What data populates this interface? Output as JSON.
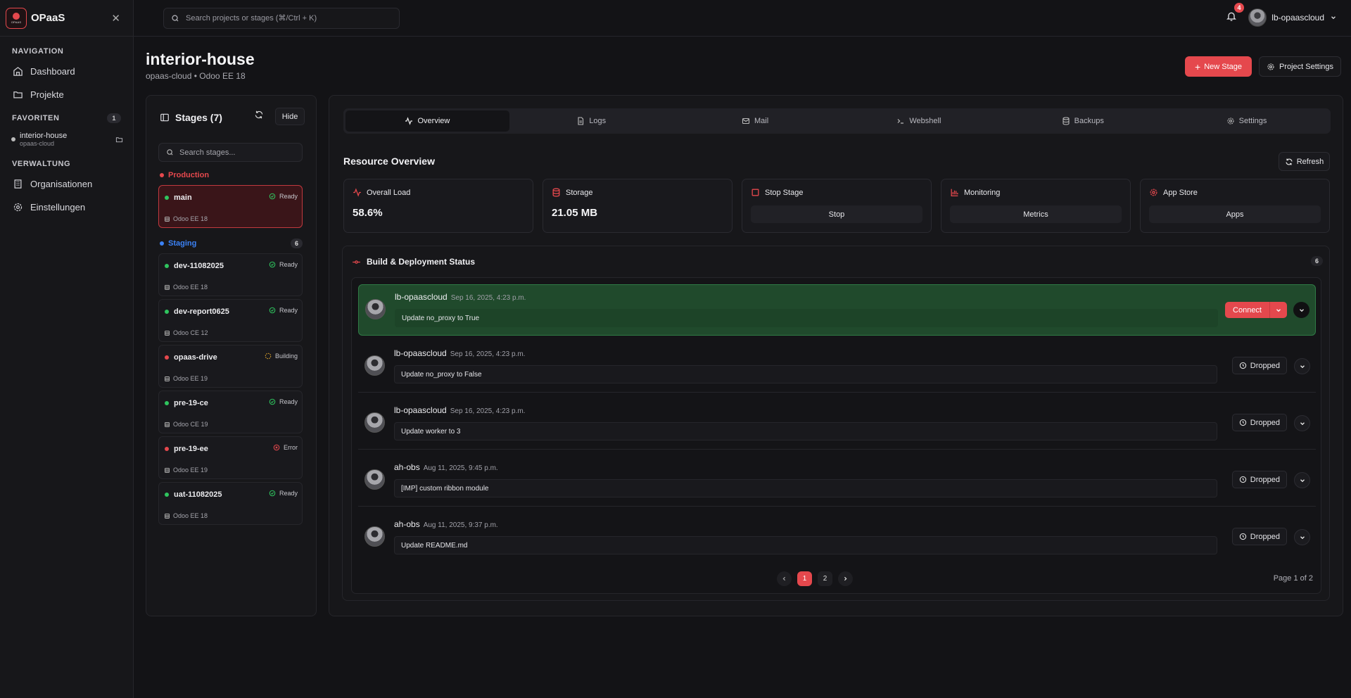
{
  "app": {
    "name": "OPaaS",
    "logo_text": "OPAAS"
  },
  "sidebar": {
    "nav_title": "NAVIGATION",
    "nav": [
      {
        "label": "Dashboard",
        "icon": "home-icon"
      },
      {
        "label": "Projekte",
        "icon": "folder-icon"
      }
    ],
    "fav_title": "FAVORITEN",
    "fav_count": "1",
    "favorites": [
      {
        "name": "interior-house",
        "org": "opaas-cloud"
      }
    ],
    "admin_title": "VERWALTUNG",
    "admin": [
      {
        "label": "Organisationen",
        "icon": "building-icon"
      },
      {
        "label": "Einstellungen",
        "icon": "gear-icon"
      }
    ]
  },
  "topbar": {
    "search_placeholder": "Search projects or stages (⌘/Ctrl + K)",
    "notifications": "4",
    "user": "lb-opaascloud"
  },
  "project": {
    "title": "interior-house",
    "subtitle": "opaas-cloud • Odoo EE 18",
    "new_stage": "New Stage",
    "settings": "Project Settings"
  },
  "stages": {
    "title": "Stages (7)",
    "hide": "Hide",
    "search_placeholder": "Search stages...",
    "production_label": "Production",
    "staging_label": "Staging",
    "staging_count": "6",
    "items": [
      {
        "name": "main",
        "status": "Ready",
        "version": "Odoo EE 18",
        "dot": "#2fc45e",
        "status_color": "#2fc45e"
      },
      {
        "name": "dev-11082025",
        "status": "Ready",
        "version": "Odoo EE 18",
        "dot": "#2fc45e",
        "status_color": "#2fc45e"
      },
      {
        "name": "dev-report0625",
        "status": "Ready",
        "version": "Odoo CE 12",
        "dot": "#2fc45e",
        "status_color": "#2fc45e"
      },
      {
        "name": "opaas-drive",
        "status": "Building",
        "version": "Odoo EE 19",
        "dot": "#e5484d",
        "status_color": "#e0a52b"
      },
      {
        "name": "pre-19-ce",
        "status": "Ready",
        "version": "Odoo CE 19",
        "dot": "#2fc45e",
        "status_color": "#2fc45e"
      },
      {
        "name": "pre-19-ee",
        "status": "Error",
        "version": "Odoo EE 19",
        "dot": "#e5484d",
        "status_color": "#e5484d"
      },
      {
        "name": "uat-11082025",
        "status": "Ready",
        "version": "Odoo EE 18",
        "dot": "#2fc45e",
        "status_color": "#2fc45e"
      }
    ]
  },
  "tabs": [
    {
      "label": "Overview",
      "icon": "activity-icon"
    },
    {
      "label": "Logs",
      "icon": "file-icon"
    },
    {
      "label": "Mail",
      "icon": "mail-icon"
    },
    {
      "label": "Webshell",
      "icon": "terminal-icon"
    },
    {
      "label": "Backups",
      "icon": "database-icon"
    },
    {
      "label": "Settings",
      "icon": "gear-icon"
    }
  ],
  "overview": {
    "title": "Resource Overview",
    "refresh": "Refresh",
    "cards": [
      {
        "label": "Overall Load",
        "value": "58.6%",
        "icon": "activity-icon"
      },
      {
        "label": "Storage",
        "value": "21.05 MB",
        "icon": "database-icon"
      },
      {
        "label": "Stop Stage",
        "action": "Stop",
        "icon": "stop-icon"
      },
      {
        "label": "Monitoring",
        "action": "Metrics",
        "icon": "chart-icon"
      },
      {
        "label": "App Store",
        "action": "Apps",
        "icon": "gear-icon"
      }
    ]
  },
  "builds": {
    "title": "Build & Deployment Status",
    "count": "6",
    "items": [
      {
        "user": "lb-opaascloud",
        "date": "Sep 16, 2025, 4:23 p.m.",
        "message": "Update no_proxy to True",
        "action": "Connect"
      },
      {
        "user": "lb-opaascloud",
        "date": "Sep 16, 2025, 4:23 p.m.",
        "message": "Update no_proxy to False",
        "action": "Dropped"
      },
      {
        "user": "lb-opaascloud",
        "date": "Sep 16, 2025, 4:23 p.m.",
        "message": "Update worker to 3",
        "action": "Dropped"
      },
      {
        "user": "ah-obs",
        "date": "Aug 11, 2025, 9:45 p.m.",
        "message": "[IMP] custom ribbon module",
        "action": "Dropped"
      },
      {
        "user": "ah-obs",
        "date": "Aug 11, 2025, 9:37 p.m.",
        "message": "Update README.md",
        "action": "Dropped"
      }
    ],
    "pages": [
      "1",
      "2"
    ],
    "page_info": "Page 1 of 2"
  },
  "colors": {
    "accent": "#e5484d",
    "ready": "#2fc45e",
    "building": "#e0a52b",
    "staging": "#3b82f6",
    "active_row": "#204a2c"
  }
}
